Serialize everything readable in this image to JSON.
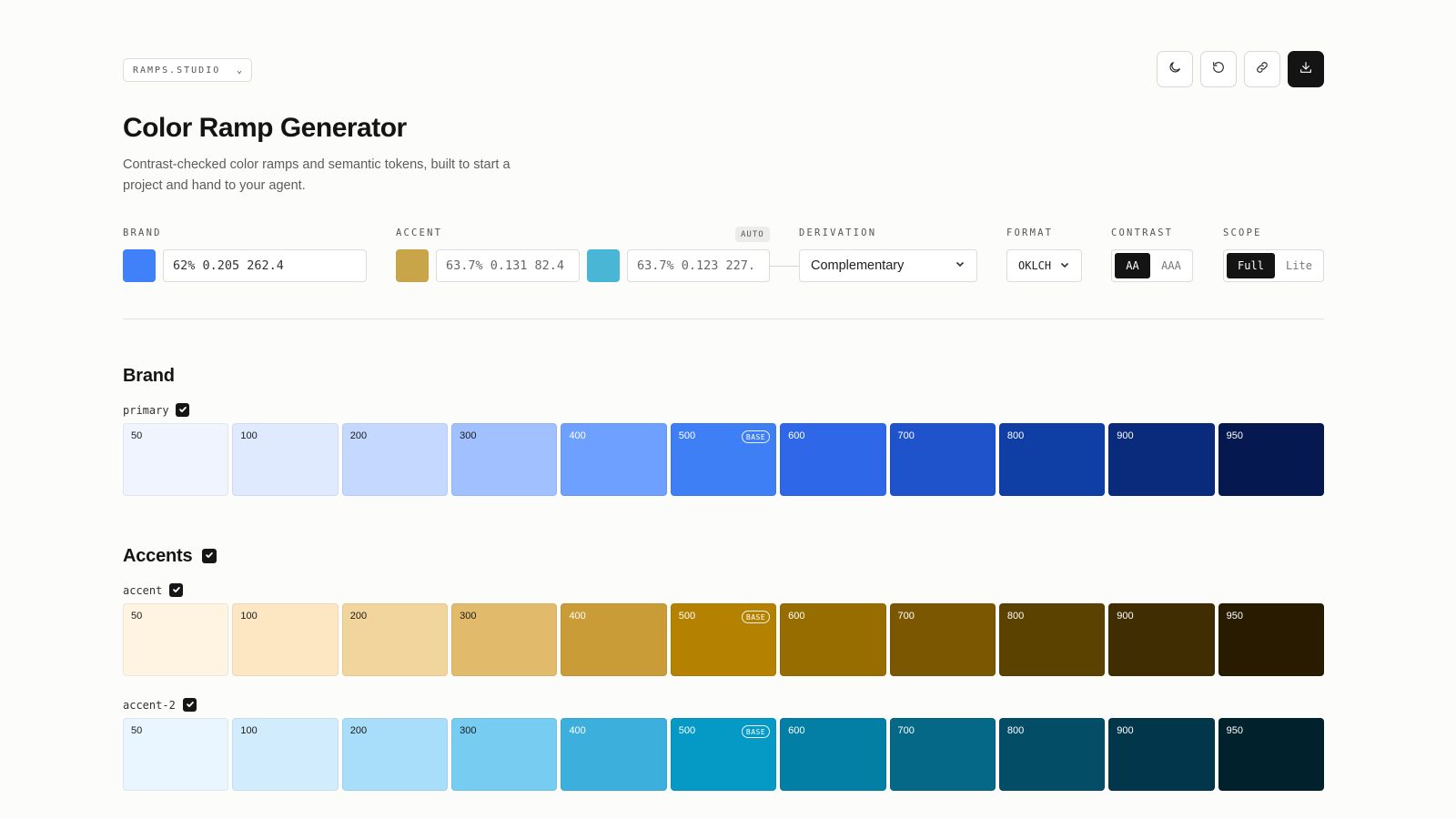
{
  "header": {
    "studio_label": "RAMPS.STUDIO",
    "title": "Color Ramp Generator",
    "subtitle": "Contrast-checked color ramps and semantic tokens, built to start a project and hand to your agent."
  },
  "toolbar": {
    "buttons": [
      {
        "name": "theme-toggle-button",
        "icon": "moon-icon"
      },
      {
        "name": "reset-button",
        "icon": "undo-icon"
      },
      {
        "name": "share-link-button",
        "icon": "link-icon"
      },
      {
        "name": "download-button",
        "icon": "download-icon"
      }
    ]
  },
  "controls": {
    "brand": {
      "label": "BRAND",
      "value": "62% 0.205 262.4",
      "swatch": "#4080f8"
    },
    "accent": {
      "label": "ACCENT",
      "auto_badge": "AUTO",
      "values": [
        {
          "value": "63.7% 0.131 82.4",
          "swatch": "#c9a54a"
        },
        {
          "value": "63.7% 0.123 227.",
          "swatch": "#4ab6d6"
        }
      ]
    },
    "derivation": {
      "label": "DERIVATION",
      "value": "Complementary"
    },
    "format": {
      "label": "FORMAT",
      "value": "OKLCH"
    },
    "contrast": {
      "label": "CONTRAST",
      "options": [
        "AA",
        "AAA"
      ],
      "selected": "AA"
    },
    "scope": {
      "label": "SCOPE",
      "options": [
        "Full",
        "Lite"
      ],
      "selected": "Full"
    }
  },
  "sections": {
    "brand": {
      "title": "Brand"
    },
    "accents": {
      "title": "Accents"
    }
  },
  "ramps": {
    "primary": {
      "name": "primary",
      "base_label": "BASE",
      "steps": [
        {
          "step": "50",
          "color": "#eff4ff",
          "text": "#1a1a1a"
        },
        {
          "step": "100",
          "color": "#dfe9ff",
          "text": "#1a1a1a"
        },
        {
          "step": "200",
          "color": "#c5d8ff",
          "text": "#1a1a1a"
        },
        {
          "step": "300",
          "color": "#a0c0ff",
          "text": "#1a1a1a"
        },
        {
          "step": "400",
          "color": "#6ea0ff",
          "text": "#ffffff"
        },
        {
          "step": "500",
          "color": "#3f7ff6",
          "text": "#ffffff",
          "base": true
        },
        {
          "step": "600",
          "color": "#2e68e8",
          "text": "#ffffff"
        },
        {
          "step": "700",
          "color": "#1f53cc",
          "text": "#ffffff"
        },
        {
          "step": "800",
          "color": "#0f3ea5",
          "text": "#ffffff"
        },
        {
          "step": "900",
          "color": "#0a2a7c",
          "text": "#ffffff"
        },
        {
          "step": "950",
          "color": "#05184f",
          "text": "#ffffff"
        }
      ]
    },
    "accent": {
      "name": "accent",
      "base_label": "BASE",
      "steps": [
        {
          "step": "50",
          "color": "#fff4e2",
          "text": "#1a1a1a"
        },
        {
          "step": "100",
          "color": "#fde6c2",
          "text": "#1a1a1a"
        },
        {
          "step": "200",
          "color": "#f2d59c",
          "text": "#1a1a1a"
        },
        {
          "step": "300",
          "color": "#e1bb6b",
          "text": "#1a1a1a"
        },
        {
          "step": "400",
          "color": "#c99c38",
          "text": "#ffffff"
        },
        {
          "step": "500",
          "color": "#b48200",
          "text": "#ffffff",
          "base": true
        },
        {
          "step": "600",
          "color": "#986d00",
          "text": "#ffffff"
        },
        {
          "step": "700",
          "color": "#7a5700",
          "text": "#ffffff"
        },
        {
          "step": "800",
          "color": "#5c4200",
          "text": "#ffffff"
        },
        {
          "step": "900",
          "color": "#402d02",
          "text": "#ffffff"
        },
        {
          "step": "950",
          "color": "#281b00",
          "text": "#ffffff"
        }
      ]
    },
    "accent2": {
      "name": "accent-2",
      "base_label": "BASE",
      "steps": [
        {
          "step": "50",
          "color": "#e9f6ff",
          "text": "#1a1a1a"
        },
        {
          "step": "100",
          "color": "#d1ecfd",
          "text": "#1a1a1a"
        },
        {
          "step": "200",
          "color": "#a8def9",
          "text": "#1a1a1a"
        },
        {
          "step": "300",
          "color": "#76ccf1",
          "text": "#1a1a1a"
        },
        {
          "step": "400",
          "color": "#3dafdc",
          "text": "#ffffff"
        },
        {
          "step": "500",
          "color": "#0599c6",
          "text": "#ffffff",
          "base": true
        },
        {
          "step": "600",
          "color": "#037fa6",
          "text": "#ffffff"
        },
        {
          "step": "700",
          "color": "#046886",
          "text": "#ffffff"
        },
        {
          "step": "800",
          "color": "#034d66",
          "text": "#ffffff"
        },
        {
          "step": "900",
          "color": "#02364a",
          "text": "#ffffff"
        },
        {
          "step": "950",
          "color": "#01222d",
          "text": "#ffffff"
        }
      ]
    }
  }
}
